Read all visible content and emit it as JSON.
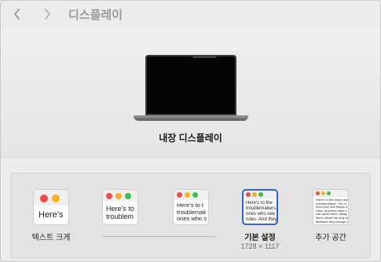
{
  "toolbar": {
    "title": "디스플레이",
    "back_icon": "chevron-left-icon",
    "forward_icon": "chevron-right-icon"
  },
  "display": {
    "name": "내장 디스플레이",
    "image_icon": "laptop-icon"
  },
  "resolution_options": [
    {
      "label": "텍스트 크게",
      "preview_text": "Here's",
      "selected": false
    },
    {
      "label": "",
      "preview_text": "Here's to\ntroublem",
      "selected": false
    },
    {
      "label": "",
      "preview_text": "Here's to t\ntroublemak\nones who s",
      "selected": false
    },
    {
      "label": "기본 설정",
      "sublabel": "1728 × 1117",
      "preview_text": "Here's to the\ntroublemakers.\nones who see\nrules. And they",
      "selected": true
    },
    {
      "label": "추가 공간",
      "preview_text": "Here's to the crazy one\ntroublemakers. The ro\nones who see things d\nrules. And they have n\ncan quote them, disag\nthem. About the only th\nBecause they change th",
      "selected": false
    }
  ],
  "colors": {
    "accent": "#2d63d4",
    "traffic_red": "#ee4c46",
    "traffic_yellow": "#f5b124",
    "traffic_green": "#3dbe4b"
  }
}
